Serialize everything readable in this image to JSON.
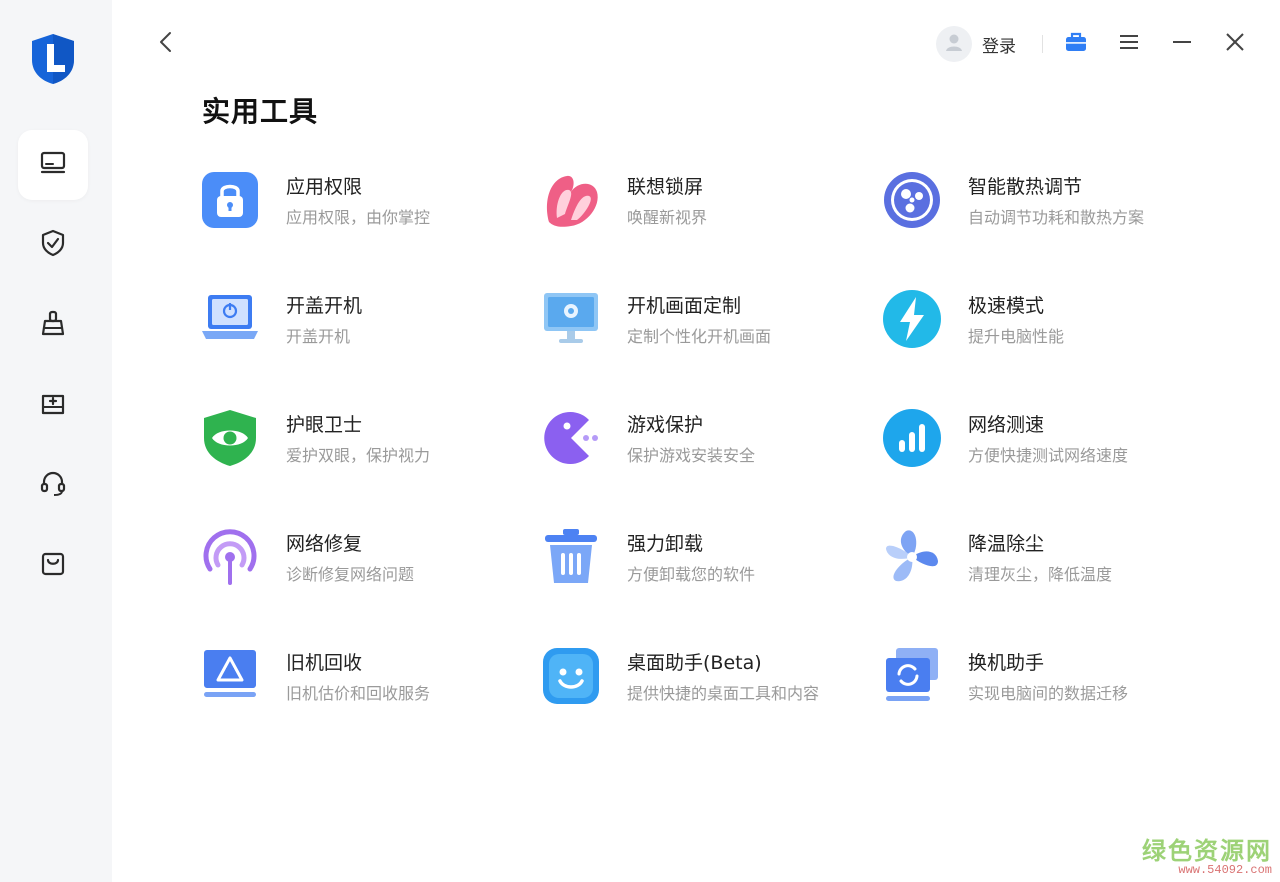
{
  "header": {
    "login_label": "登录",
    "page_title": "实用工具"
  },
  "sidebar": {
    "items": [
      {
        "icon": "computer-icon",
        "active": true
      },
      {
        "icon": "shield-check-icon",
        "active": false
      },
      {
        "icon": "broom-icon",
        "active": false
      },
      {
        "icon": "driver-box-icon",
        "active": false
      },
      {
        "icon": "headset-icon",
        "active": false
      },
      {
        "icon": "shopping-bag-icon",
        "active": false
      }
    ]
  },
  "tools": [
    {
      "name": "应用权限",
      "desc": "应用权限，由你掌控",
      "icon": "lock-icon"
    },
    {
      "name": "联想锁屏",
      "desc": "唤醒新视界",
      "icon": "lenovo-lockscreen-icon"
    },
    {
      "name": "智能散热调节",
      "desc": "自动调节功耗和散热方案",
      "icon": "fan-cooling-icon"
    },
    {
      "name": "开盖开机",
      "desc": "开盖开机",
      "icon": "laptop-power-icon"
    },
    {
      "name": "开机画面定制",
      "desc": "定制个性化开机画面",
      "icon": "monitor-gear-icon"
    },
    {
      "name": "极速模式",
      "desc": "提升电脑性能",
      "icon": "lightning-icon"
    },
    {
      "name": "护眼卫士",
      "desc": "爱护双眼，保护视力",
      "icon": "eye-shield-icon"
    },
    {
      "name": "游戏保护",
      "desc": "保护游戏安装安全",
      "icon": "game-pacman-icon"
    },
    {
      "name": "网络测速",
      "desc": "方便快捷测试网络速度",
      "icon": "speed-bars-icon"
    },
    {
      "name": "网络修复",
      "desc": "诊断修复网络问题",
      "icon": "antenna-icon"
    },
    {
      "name": "强力卸载",
      "desc": "方便卸载您的软件",
      "icon": "trash-icon"
    },
    {
      "name": "降温除尘",
      "desc": "清理灰尘，降低温度",
      "icon": "cooling-fan-icon"
    },
    {
      "name": "旧机回收",
      "desc": "旧机估价和回收服务",
      "icon": "recycle-icon"
    },
    {
      "name": "桌面助手(Beta)",
      "desc": "提供快捷的桌面工具和内容",
      "icon": "smile-assistant-icon"
    },
    {
      "name": "换机助手",
      "desc": "实现电脑间的数据迁移",
      "icon": "data-transfer-icon"
    }
  ],
  "watermark": {
    "main": "绿色资源网",
    "sub": "www.54092.com"
  },
  "colors": {
    "sidebar_bg": "#f5f6f8",
    "accent_blue": "#3b82f6",
    "muted_text": "#9a9a9a"
  }
}
